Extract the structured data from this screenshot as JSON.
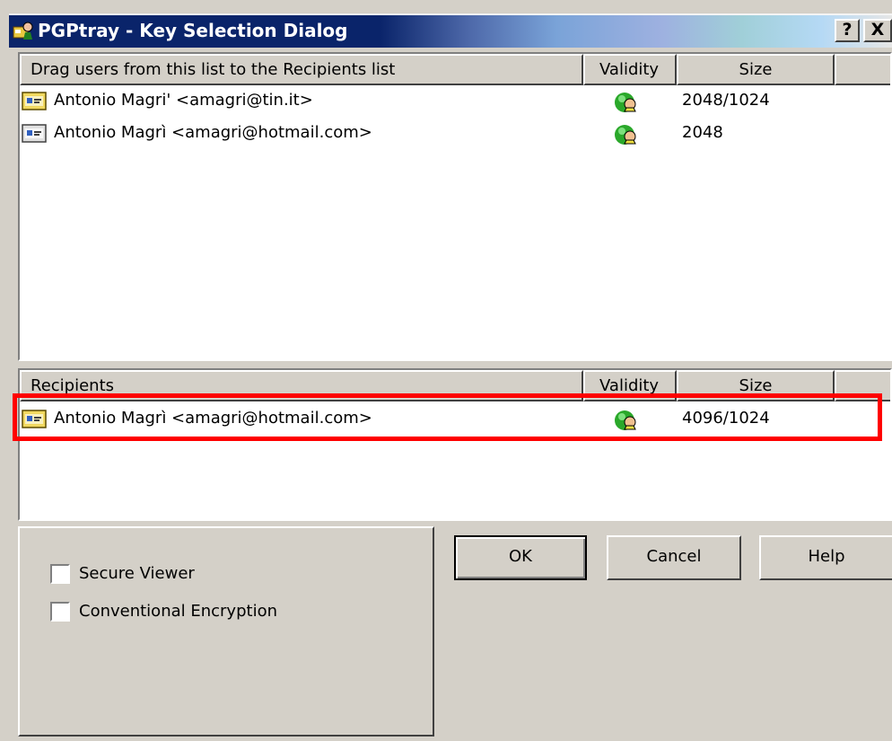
{
  "window": {
    "title": "PGPtray - Key Selection Dialog",
    "help_button": "?",
    "close_button": "X"
  },
  "source_list": {
    "columns": [
      "Drag users from this list to the Recipients list",
      "Validity",
      "Size",
      ""
    ],
    "rows": [
      {
        "name": "Antonio Magri' <amagri@tin.it>",
        "validity": "valid-key-icon",
        "size": "2048/1024"
      },
      {
        "name": "Antonio Magrì <amagri@hotmail.com>",
        "validity": "valid-key-icon",
        "size": "2048"
      }
    ]
  },
  "recipients_list": {
    "columns": [
      "Recipients",
      "Validity",
      "Size",
      ""
    ],
    "rows": [
      {
        "name": "Antonio Magrì <amagri@hotmail.com>",
        "validity": "valid-key-icon",
        "size": "4096/1024"
      }
    ]
  },
  "options": {
    "secure_viewer": {
      "label": "Secure Viewer",
      "checked": false
    },
    "conventional_encryption": {
      "label": "Conventional Encryption",
      "checked": false
    }
  },
  "buttons": {
    "ok": "OK",
    "cancel": "Cancel",
    "help": "Help"
  },
  "colors": {
    "highlight": "#ff0000",
    "titlebar": "#0a246a",
    "face": "#d4d0c8"
  }
}
